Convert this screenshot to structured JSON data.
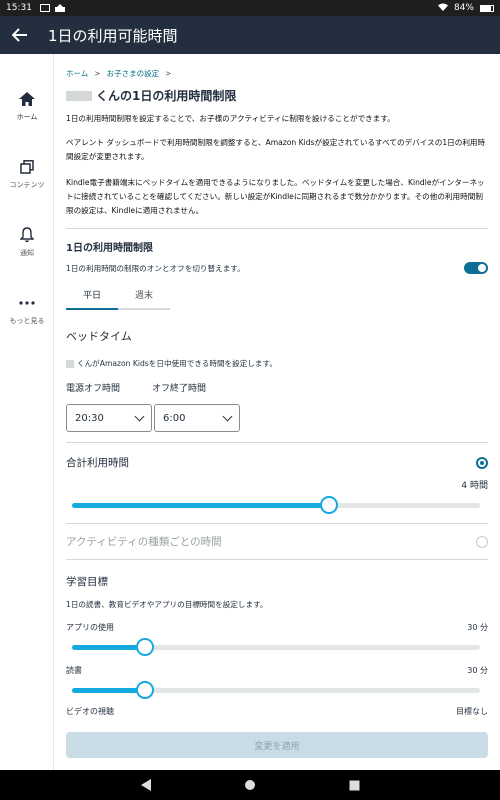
{
  "status_bar": {
    "time": "15:31",
    "battery": "84%"
  },
  "app_bar": {
    "title": "1日の利用可能時間"
  },
  "sidenav": [
    {
      "label": "ホーム",
      "icon": "home-icon"
    },
    {
      "label": "コンテンツ",
      "icon": "content-icon"
    },
    {
      "label": "通知",
      "icon": "bell-icon"
    },
    {
      "label": "もっと見る",
      "icon": "more-icon"
    }
  ],
  "breadcrumb": {
    "home": "ホーム",
    "sep": ">",
    "settings": "お子さまの設定",
    "sep2": ">"
  },
  "page": {
    "title": "くんの1日の利用時間制限",
    "para1": "1日の利用時間制限を設定することで、お子様のアクティビティに制限を設けることができます。",
    "para2": "ペアレント ダッシュボードで利用時間制限を調整すると、Amazon Kidsが設定されているすべてのデバイスの1日の利用時間設定が変更されます。",
    "para3": "Kindle電子書籍端末にベッドタイムを適用できるようになりました。ベッドタイムを変更した場合、Kindleがインターネットに接続されていることを確認してください。新しい設定がKindleに同期されるまで数分かかります。その他の利用時間制限の設定は、Kindleに適用されません。"
  },
  "daily_limit": {
    "title": "1日の利用時間制限",
    "toggle_label": "1日の利用時間の制限のオンとオフを切り替えます。",
    "toggle_on": true
  },
  "tabs": [
    {
      "label": "平日"
    },
    {
      "label": "週末"
    }
  ],
  "bedtime": {
    "title": "ベッドタイム",
    "desc": "くんがAmazon Kidsを日中使用できる時間を設定します。",
    "off_label": "電源オフ時間",
    "end_label": "オフ終了時間",
    "off_value": "20:30",
    "end_value": "6:00"
  },
  "total": {
    "label": "合計利用時間",
    "value_text": "4 時間",
    "fraction": 0.63
  },
  "by_activity": {
    "label": "アクティビティの種類ごとの時間"
  },
  "goals": {
    "title": "学習目標",
    "desc": "1日の読書、教育ビデオやアプリの目標時間を設定します。",
    "apps": {
      "label": "アプリの使用",
      "value": "30 分",
      "fraction": 0.18
    },
    "reading": {
      "label": "読書",
      "value": "30 分",
      "fraction": 0.18
    },
    "video": {
      "label": "ビデオの視聴",
      "value": "目標なし"
    }
  },
  "apply_button": "変更を適用",
  "colors": {
    "accent": "#0b6f94",
    "slider": "#16a9e0",
    "header": "#232f3e"
  }
}
